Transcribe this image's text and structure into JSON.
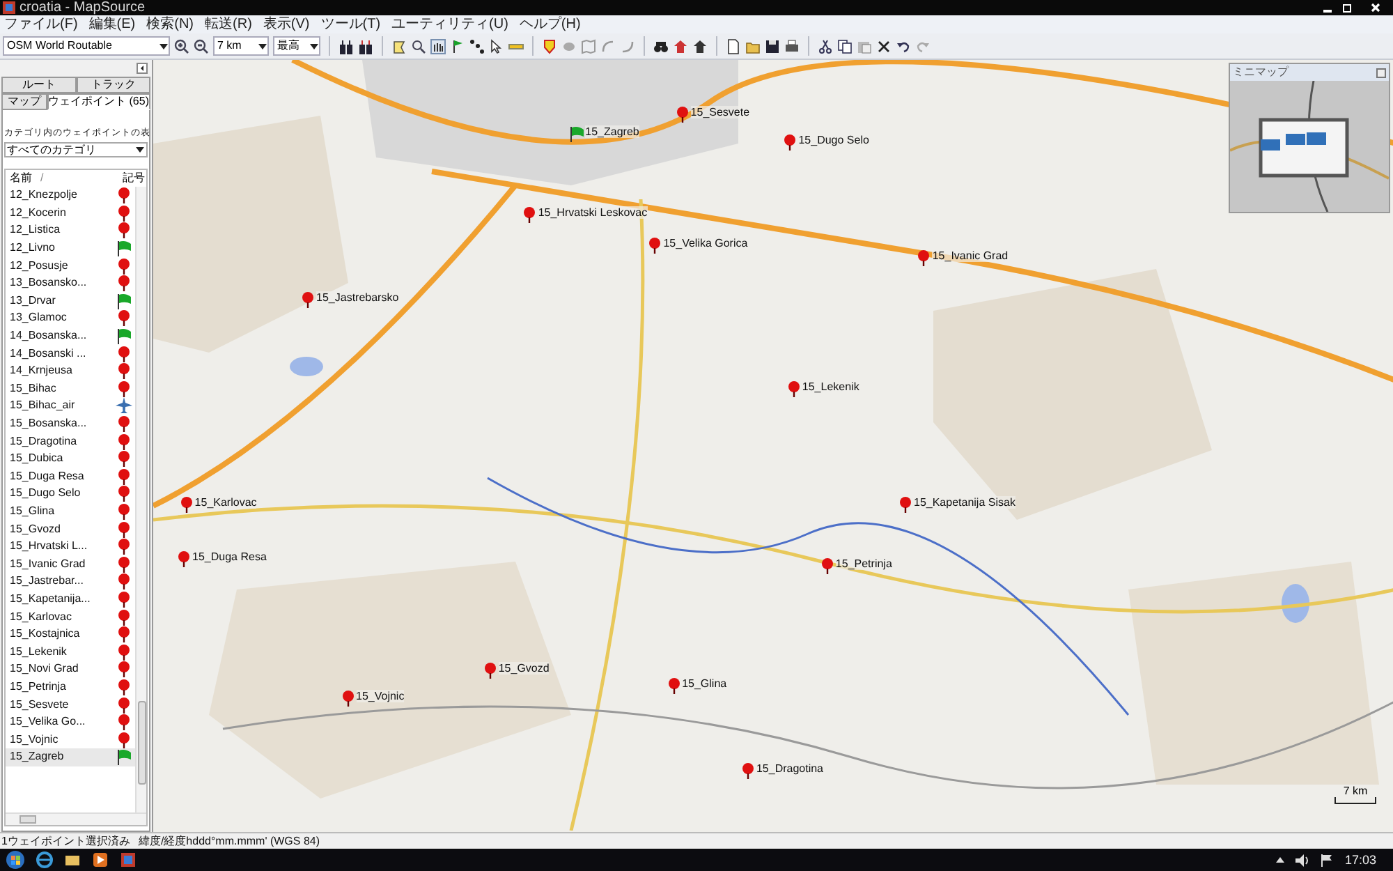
{
  "window": {
    "title": "croatia - MapSource"
  },
  "menu": [
    "ファイル(F)",
    "編集(E)",
    "検索(N)",
    "転送(R)",
    "表示(V)",
    "ツール(T)",
    "ユーティリティ(U)",
    "ヘルプ(H)"
  ],
  "toolbar": {
    "map_product": "OSM World Routable",
    "zoom": "7 km",
    "detail": "最高"
  },
  "sidebar": {
    "tabs": [
      {
        "label": "ルート",
        "selected": false
      },
      {
        "label": "トラック",
        "selected": false
      },
      {
        "label": "マップ",
        "selected": false
      },
      {
        "label": "ウェイポイント (65)",
        "selected": true
      }
    ],
    "category_label": "カテゴリ内のウェイポイントの表",
    "category": "すべてのカテゴリ",
    "columns": [
      "名前",
      "/",
      "記号"
    ],
    "rows": [
      {
        "name": "12_Knezpolje",
        "kind": "pin",
        "selected": false
      },
      {
        "name": "12_Kocerin",
        "kind": "pin",
        "selected": false
      },
      {
        "name": "12_Listica",
        "kind": "pin",
        "selected": false
      },
      {
        "name": "12_Livno",
        "kind": "flag",
        "selected": false
      },
      {
        "name": "12_Posusje",
        "kind": "pin",
        "selected": false
      },
      {
        "name": "13_Bosansko...",
        "kind": "pin",
        "selected": false
      },
      {
        "name": "13_Drvar",
        "kind": "flag",
        "selected": false
      },
      {
        "name": "13_Glamoc",
        "kind": "pin",
        "selected": false
      },
      {
        "name": "14_Bosanska...",
        "kind": "flag",
        "selected": false
      },
      {
        "name": "14_Bosanski ...",
        "kind": "pin",
        "selected": false
      },
      {
        "name": "14_Krnjeusa",
        "kind": "pin",
        "selected": false
      },
      {
        "name": "15_Bihac",
        "kind": "pin",
        "selected": false
      },
      {
        "name": "15_Bihac_air",
        "kind": "plane",
        "selected": false
      },
      {
        "name": "15_Bosanska...",
        "kind": "pin",
        "selected": false
      },
      {
        "name": "15_Dragotina",
        "kind": "pin",
        "selected": false
      },
      {
        "name": "15_Dubica",
        "kind": "pin",
        "selected": false
      },
      {
        "name": "15_Duga Resa",
        "kind": "pin",
        "selected": false
      },
      {
        "name": "15_Dugo Selo",
        "kind": "pin",
        "selected": false
      },
      {
        "name": "15_Glina",
        "kind": "pin",
        "selected": false
      },
      {
        "name": "15_Gvozd",
        "kind": "pin",
        "selected": false
      },
      {
        "name": "15_Hrvatski L...",
        "kind": "pin",
        "selected": false
      },
      {
        "name": "15_Ivanic Grad",
        "kind": "pin",
        "selected": false
      },
      {
        "name": "15_Jastrebar...",
        "kind": "pin",
        "selected": false
      },
      {
        "name": "15_Kapetanija...",
        "kind": "pin",
        "selected": false
      },
      {
        "name": "15_Karlovac",
        "kind": "pin",
        "selected": false
      },
      {
        "name": "15_Kostajnica",
        "kind": "pin",
        "selected": false
      },
      {
        "name": "15_Lekenik",
        "kind": "pin",
        "selected": false
      },
      {
        "name": "15_Novi Grad",
        "kind": "pin",
        "selected": false
      },
      {
        "name": "15_Petrinja",
        "kind": "pin",
        "selected": false
      },
      {
        "name": "15_Sesvete",
        "kind": "pin",
        "selected": false
      },
      {
        "name": "15_Velika Go...",
        "kind": "pin",
        "selected": false
      },
      {
        "name": "15_Vojnic",
        "kind": "pin",
        "selected": false
      },
      {
        "name": "15_Zagreb",
        "kind": "flag",
        "selected": true
      }
    ]
  },
  "map": {
    "waypoints": [
      {
        "label": "15_Sesvete",
        "kind": "pin"
      },
      {
        "label": "15_Zagreb",
        "kind": "flag"
      },
      {
        "label": "15_Dugo Selo",
        "kind": "pin"
      },
      {
        "label": "15_Hrvatski Leskovac",
        "kind": "pin"
      },
      {
        "label": "15_Velika Gorica",
        "kind": "pin"
      },
      {
        "label": "15_Ivanic Grad",
        "kind": "pin"
      },
      {
        "label": "15_Jastrebarsko",
        "kind": "pin"
      },
      {
        "label": "15_Lekenik",
        "kind": "pin"
      },
      {
        "label": "15_Karlovac",
        "kind": "pin"
      },
      {
        "label": "15_Kapetanija Sisak",
        "kind": "pin"
      },
      {
        "label": "15_Duga Resa",
        "kind": "pin"
      },
      {
        "label": "15_Petrinja",
        "kind": "pin"
      },
      {
        "label": "15_Gvozd",
        "kind": "pin"
      },
      {
        "label": "15_Glina",
        "kind": "pin"
      },
      {
        "label": "15_Vojnic",
        "kind": "pin"
      },
      {
        "label": "15_Dragotina",
        "kind": "pin"
      }
    ],
    "scale": "7 km"
  },
  "minimap": {
    "title": "ミニマップ"
  },
  "status_bar": [
    "1ウェイポイント選択済み",
    "緯度/経度hddd°mm.mmm' (WGS 84)"
  ],
  "taskbar": {
    "clock": "17:03"
  }
}
